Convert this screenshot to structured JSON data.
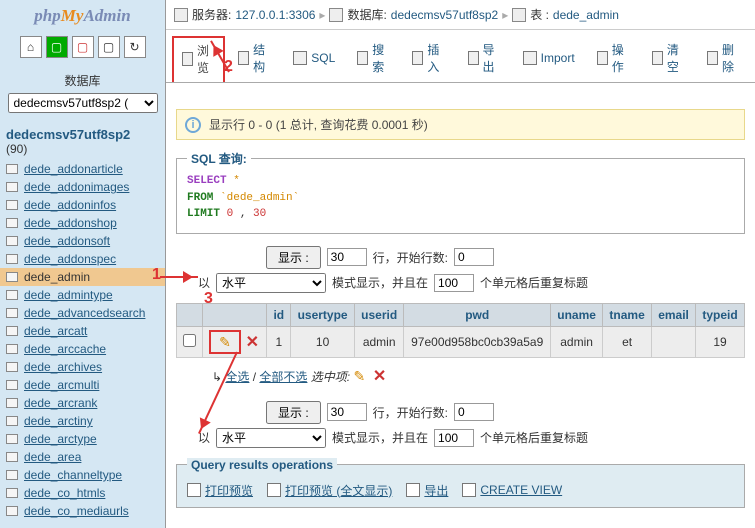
{
  "logo": {
    "part1": "php",
    "part2": "My",
    "part3": "Admin"
  },
  "sidebar": {
    "db_label": "数据库",
    "db_selected": "dedecmsv57utf8sp2 ( ",
    "db_name": "dedecmsv57utf8sp2",
    "db_count": "(90)",
    "tables": [
      "dede_addonarticle",
      "dede_addonimages",
      "dede_addoninfos",
      "dede_addonshop",
      "dede_addonsoft",
      "dede_addonspec",
      "dede_admin",
      "dede_admintype",
      "dede_advancedsearch",
      "dede_arcatt",
      "dede_arccache",
      "dede_archives",
      "dede_arcmulti",
      "dede_arcrank",
      "dede_arctiny",
      "dede_arctype",
      "dede_area",
      "dede_channeltype",
      "dede_co_htmls",
      "dede_co_mediaurls"
    ],
    "selected_index": 6
  },
  "breadcrumb": {
    "server_label": "服务器: ",
    "server_value": "127.0.0.1:3306",
    "db_label": "数据库: ",
    "db_value": "dedecmsv57utf8sp2",
    "table_label": "表 : ",
    "table_value": "dede_admin"
  },
  "tabs": {
    "browse": "浏览",
    "structure": "结构",
    "sql": "SQL",
    "search": "搜索",
    "insert": "插入",
    "export": "导出",
    "import": "Import",
    "operations": "操作",
    "empty": "清空",
    "drop": "删除"
  },
  "info": {
    "text_prefix": "显示行 0 - 0",
    "text_suffix": " (1 总计, 查询花费 0.0001 秒)"
  },
  "sql": {
    "legend": "SQL 查询:",
    "select": "SELECT",
    "star": "*",
    "from": "FROM",
    "table": "`dede_admin`",
    "limit": "LIMIT",
    "n1": "0",
    "comma": " , ",
    "n2": "30"
  },
  "controls": {
    "show_btn": "显示 :",
    "rows_value": "30",
    "rows_suffix": "行，开始行数:",
    "start_value": "0",
    "yi": "以",
    "mode_value": "水平",
    "mode_suffix": "模式显示，并且在",
    "repeat_value": "100",
    "repeat_suffix": "个单元格后重复标题"
  },
  "table": {
    "headers": {
      "id": "id",
      "usertype": "usertype",
      "userid": "userid",
      "pwd": "pwd",
      "uname": "uname",
      "tname": "tname",
      "email": "email",
      "typeid": "typeid"
    },
    "row": {
      "id": "1",
      "usertype": "10",
      "userid": "admin",
      "pwd": "97e00d958bc0cb39a5a9",
      "uname": "admin",
      "tname": "et",
      "email": "",
      "typeid": "19"
    },
    "select_all": "全选",
    "select_none": "全部不选",
    "select_suffix": "选中项:"
  },
  "qro": {
    "legend": "Query results operations",
    "print": "打印预览",
    "print_full": "打印预览 (全文显示)",
    "export": "导出",
    "create_view": "CREATE VIEW"
  },
  "annotations": {
    "n1": "1",
    "n2": "2",
    "n3": "3"
  }
}
